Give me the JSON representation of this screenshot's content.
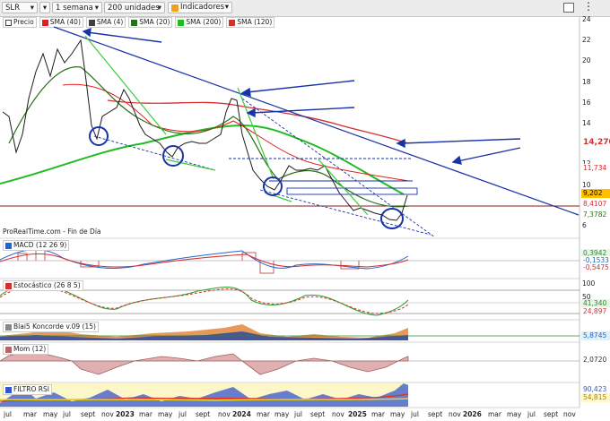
{
  "toolbar": {
    "symbol": "SLR",
    "symbol_arrow": "▾",
    "menu_arrow": "▾",
    "timeframe": "1 semana",
    "units": "200 unidades",
    "indicators": "Indicadores",
    "window_icon": "window-icon",
    "more_icon": "more-icon"
  },
  "legend": [
    {
      "label": "Precio",
      "color": "#ffffff"
    },
    {
      "label": "SMA (40)",
      "color": "#e02020"
    },
    {
      "label": "SMA (4)",
      "color": "#404040"
    },
    {
      "label": "SMA (20)",
      "color": "#2b6e1a"
    },
    {
      "label": "SMA (200)",
      "color": "#22bb22"
    },
    {
      "label": "SMA (120)",
      "color": "#d43030"
    }
  ],
  "source": "ProRealTime.com - Fin de Día",
  "price_axis": [
    "24",
    "22",
    "20",
    "18",
    "16",
    "14",
    "12",
    "10",
    "8",
    "6"
  ],
  "price_tags": [
    {
      "value": "14,270",
      "color": "#d43030"
    },
    {
      "value": "11,734",
      "color": "#e02020"
    },
    {
      "value": "9,202",
      "color": "#ffc000"
    },
    {
      "value": "8,4107",
      "color": "#d43030"
    },
    {
      "value": "7,3782",
      "color": "#2b6e1a"
    }
  ],
  "panels": [
    {
      "label": "MACD (12 26 9)",
      "axis": [],
      "tags": [
        "0,3942",
        "-0,1533",
        "-0,5475"
      ]
    },
    {
      "label": "Estocástico (26 8 5)",
      "axis": [
        "100",
        "50",
        "0"
      ],
      "tags": [
        "41,340",
        "24,897"
      ]
    },
    {
      "label": "Blai5 Koncorde v.09 (15)",
      "axis": [],
      "tags": [
        "5,8745"
      ]
    },
    {
      "label": "Mom (12)",
      "axis": [],
      "tags": [
        "2,0720"
      ]
    },
    {
      "label": "FILTRO RSI",
      "axis": [],
      "tags": [
        "90,423",
        "54,815"
      ]
    }
  ],
  "time_axis": [
    {
      "t": "jul"
    },
    {
      "t": "mar"
    },
    {
      "t": "may"
    },
    {
      "t": "jul"
    },
    {
      "t": "sept"
    },
    {
      "t": "nov"
    },
    {
      "t": "2023",
      "bold": true
    },
    {
      "t": "mar"
    },
    {
      "t": "may"
    },
    {
      "t": "jul"
    },
    {
      "t": "sept"
    },
    {
      "t": "nov"
    },
    {
      "t": "2024",
      "bold": true
    },
    {
      "t": "mar"
    },
    {
      "t": "may"
    },
    {
      "t": "jul"
    },
    {
      "t": "sept"
    },
    {
      "t": "nov"
    },
    {
      "t": "2025",
      "bold": true
    },
    {
      "t": "mar"
    },
    {
      "t": "may"
    },
    {
      "t": "jul"
    },
    {
      "t": "sept"
    },
    {
      "t": "nov"
    },
    {
      "t": "2026",
      "bold": true
    },
    {
      "t": "mar"
    },
    {
      "t": "may"
    },
    {
      "t": "jul"
    },
    {
      "t": "sept"
    },
    {
      "t": "nov"
    }
  ]
}
